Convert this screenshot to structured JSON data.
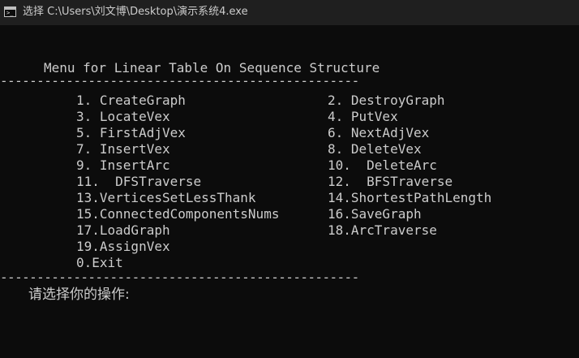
{
  "window": {
    "title": "选择 C:\\Users\\刘文博\\Desktop\\演示系统4.exe",
    "icon": "console-icon",
    "background_color": "#0c0c0c",
    "text_color": "#cccccc"
  },
  "console": {
    "menu_title": "Menu for Linear Table On Sequence Structure",
    "separator": "-------------------------------------------------",
    "left_column": [
      "1. CreateGraph",
      "3. LocateVex",
      "5. FirstAdjVex",
      "7. InsertVex",
      "9. InsertArc",
      "11.  DFSTraverse",
      "13.VerticesSetLessThank",
      "15.ConnectedComponentsNums",
      "17.LoadGraph",
      "19.AssignVex",
      "0.Exit"
    ],
    "right_column": [
      "2. DestroyGraph",
      "4. PutVex",
      "6. NextAdjVex",
      "8. DeleteVex",
      "10.  DeleteArc",
      "12.  BFSTraverse",
      "14.ShortestPathLength",
      "16.SaveGraph",
      "18.ArcTraverse"
    ],
    "prompt": "请选择你的操作:"
  }
}
